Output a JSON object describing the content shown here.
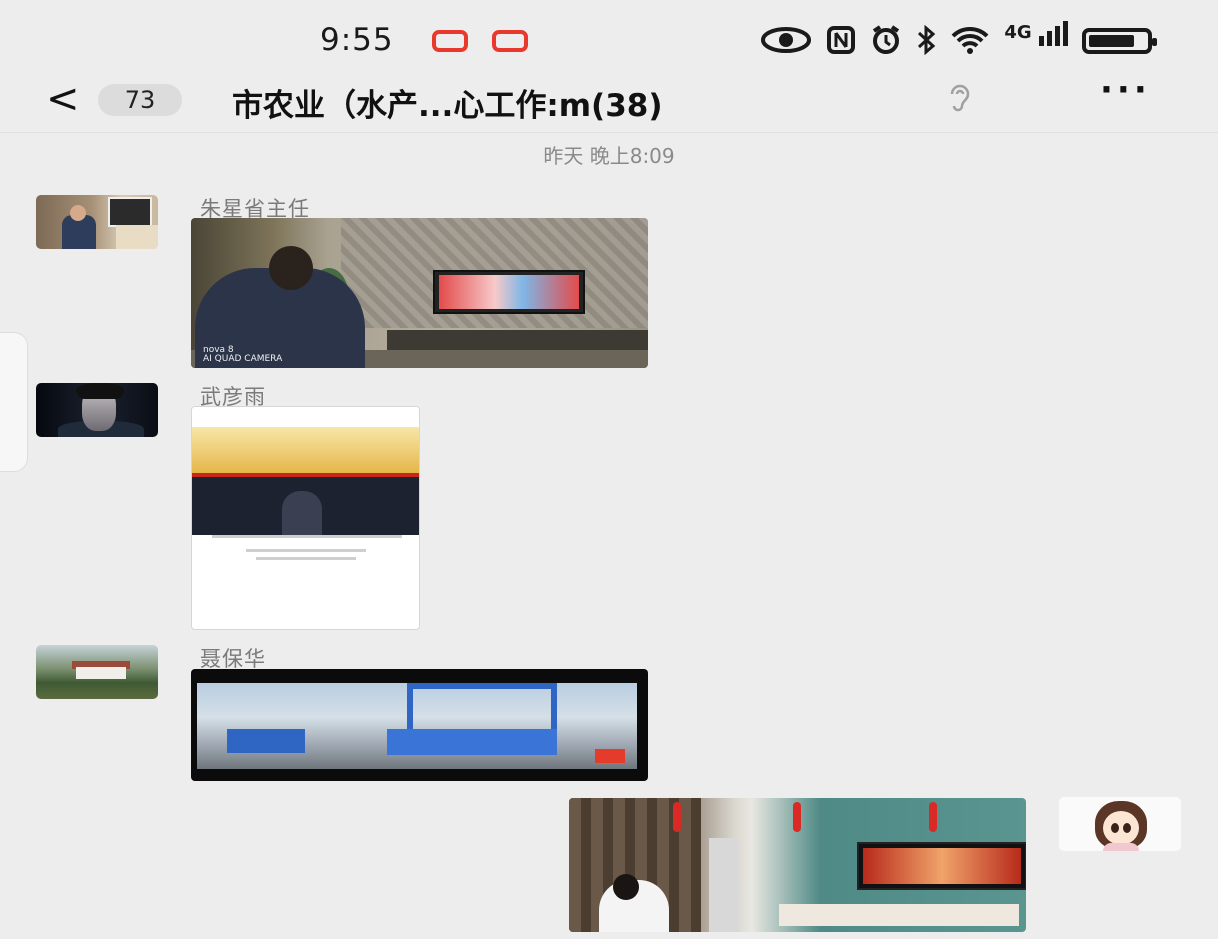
{
  "status_bar": {
    "time": "9:55",
    "network_label": "4G",
    "icons": [
      "recording-icon",
      "recording-icon",
      "eye-icon",
      "nfc-icon",
      "alarm-icon",
      "bluetooth-icon",
      "wifi-icon",
      "signal-icon",
      "battery-icon"
    ],
    "battery_level": 0.8
  },
  "header": {
    "back_glyph": "<",
    "unread_count": "73",
    "title": "市农业（水产...心工作:m(38)",
    "more_glyph": "···"
  },
  "timestamp": "昨天 晚上8:09",
  "messages": [
    {
      "sender": "朱星省主任",
      "type": "image",
      "watermark": "nova 8\nAI QUAD CAMERA"
    },
    {
      "sender": "武彦雨",
      "type": "image"
    },
    {
      "sender": "聂保华",
      "type": "image"
    },
    {
      "sender": "",
      "type": "image",
      "self": true
    }
  ],
  "colors": {
    "background": "#ededed",
    "record_red": "#e8392c",
    "sender_gray": "#7a7a7a"
  }
}
